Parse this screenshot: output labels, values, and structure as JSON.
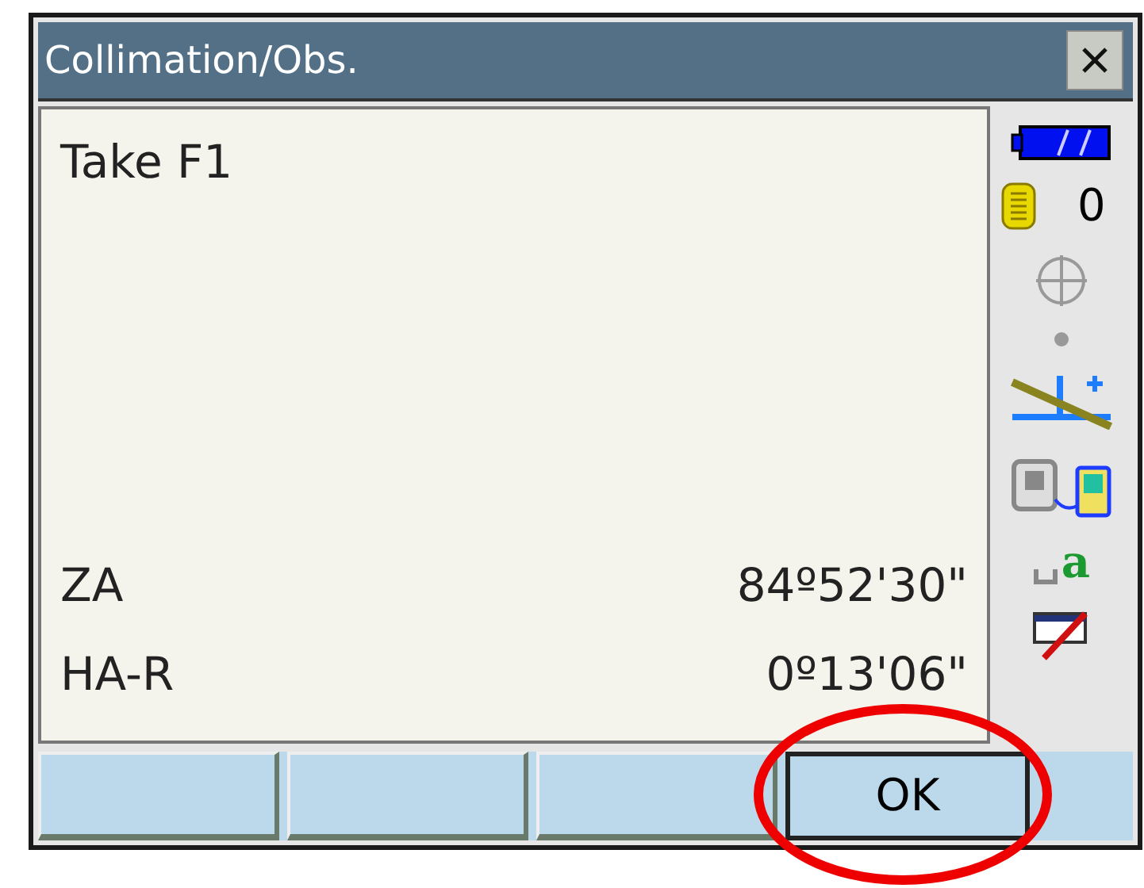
{
  "window": {
    "title": "Collimation/Obs."
  },
  "prompt": "Take F1",
  "readings": [
    {
      "label": "ZA",
      "value": "84º52'30\""
    },
    {
      "label": "HA-R",
      "value": "0º13'06\""
    }
  ],
  "status": {
    "memory_count": "0",
    "input_mode": "a"
  },
  "softkeys": [
    {
      "kind": "blank"
    },
    {
      "kind": "blank"
    },
    {
      "kind": "blank"
    },
    {
      "kind": "button",
      "label": "OK"
    }
  ],
  "annotation": {
    "kind": "ellipse",
    "color": "#ee0000"
  }
}
